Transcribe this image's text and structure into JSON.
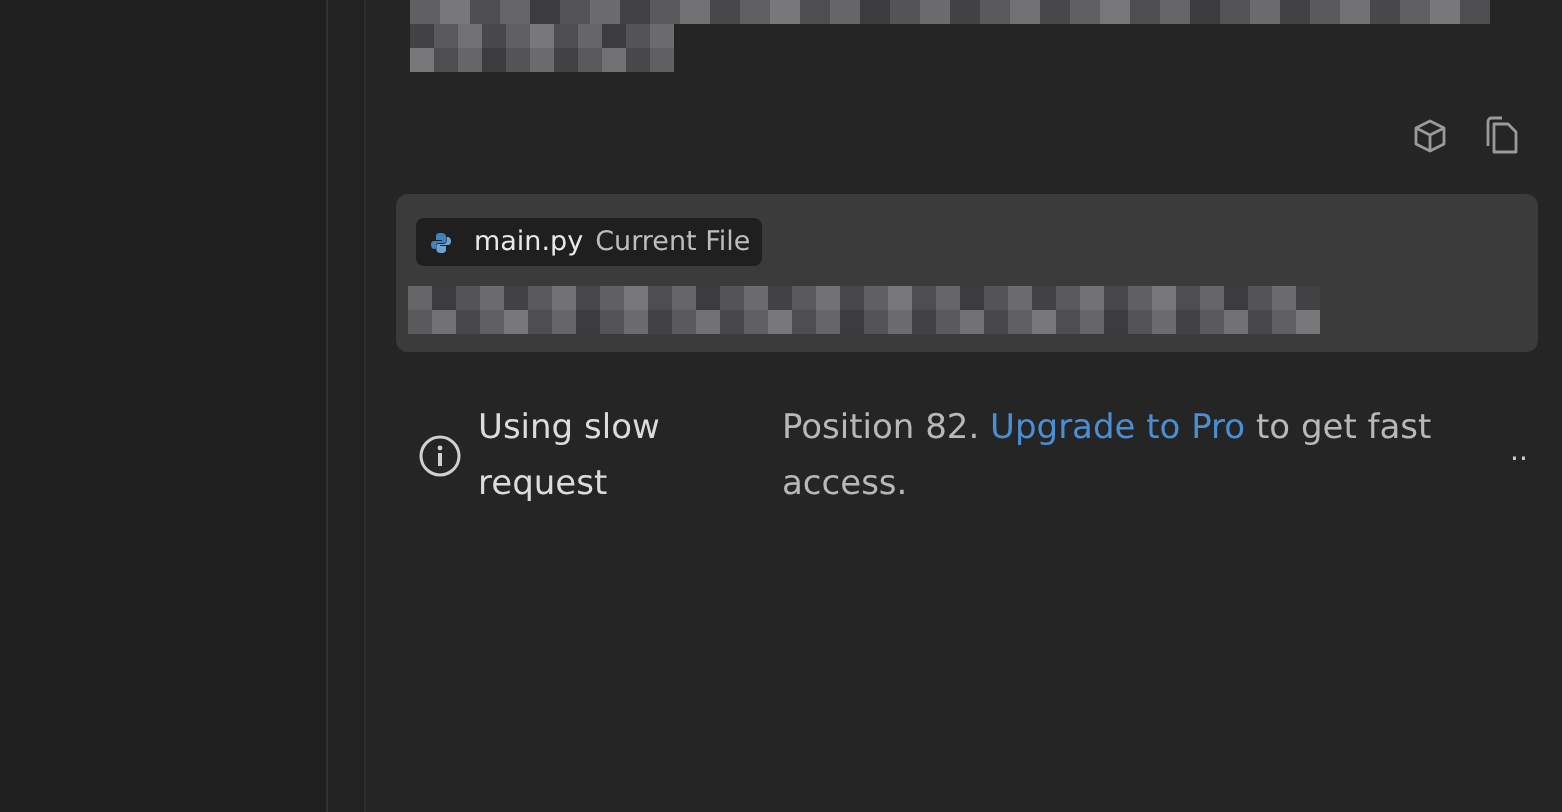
{
  "chip": {
    "filename": "main.py",
    "label": "Current File"
  },
  "notice": {
    "title": "Using slow request",
    "text_before": "Position 82. ",
    "link": "Upgrade to Pro",
    "text_after": " to get fast access.",
    "trailing": ".."
  }
}
